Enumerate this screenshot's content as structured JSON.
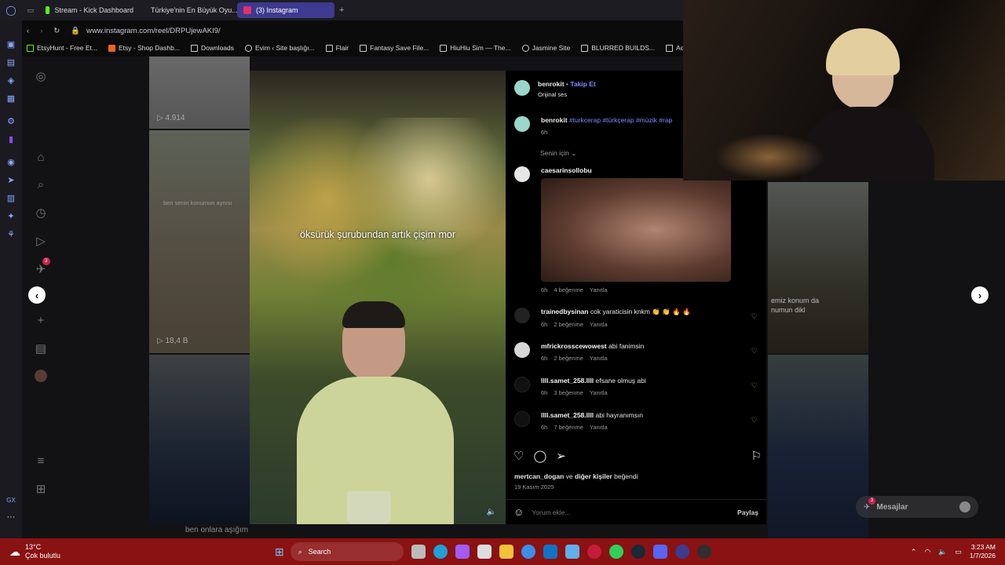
{
  "tabs": [
    {
      "label": "Stream - Kick Dashboard",
      "color": "#53fc18"
    },
    {
      "label": "Türkiye'nin En Büyük Oyu...",
      "color": "#f4b400"
    },
    {
      "label": "(3) Instagram",
      "color": "#e1306c"
    }
  ],
  "new_tab": "+",
  "url": "www.instagram.com/reel/DRPUjewAKI9/",
  "bookmarks": [
    "EtsyHunt - Free Et...",
    "Etsy - Shop Dashb...",
    "Downloads",
    "Evim ‹ Site başlığı...",
    "Flair",
    "Fantasy Save File...",
    "HiuHiu Sim — The...",
    "Jasmine Site",
    "BLURRED BUILDS...",
    "Acco"
  ],
  "grid": {
    "views_top": "4.914",
    "overlay_left": "ben senin konumun aynısı",
    "views_mid": "18,4 B",
    "caption_bottom_left": "ben onlara aşığım",
    "overlay_right": "emiz konum da\nnumun dikl"
  },
  "video": {
    "caption": "öksürük şurubundan artık çişim mor"
  },
  "post": {
    "author": "benrokit",
    "follow": "Takip Et",
    "audio": "Orijinal ses",
    "caption_user": "benrokit",
    "caption_tags": "#turkcerap #türkçerap #müzik #rap",
    "caption_time": "6h",
    "sort": "Senin için",
    "comments": [
      {
        "user": "caesarinsollobu",
        "text": "",
        "time": "6h",
        "likes": "4 beğenme",
        "reply": "Yanıtla"
      },
      {
        "user": "trainedbysinan",
        "text": "cok yaraticisin knkm 👏 👏 🔥 🔥",
        "time": "6h",
        "likes": "2 beğenme",
        "reply": "Yanıtla"
      },
      {
        "user": "mfrickrosscewowest",
        "text": "abi fanimsin",
        "time": "6h",
        "likes": "2 beğenme",
        "reply": "Yanıtla"
      },
      {
        "user": "llll.samet_258.llll",
        "text": "efsane olmuş abi",
        "time": "6h",
        "likes": "3 beğenme",
        "reply": "Yanıtla"
      },
      {
        "user": "llll.samet_258.llll",
        "text": "abi hayranımsın",
        "time": "6h",
        "likes": "7 beğenme",
        "reply": "Yanıtla"
      }
    ],
    "liked_by_user": "mertcan_dogan",
    "liked_by_rest": "ve",
    "liked_by_others": "diğer kişiler",
    "liked_by_suffix": "beğendi",
    "date": "19 Kasım 2025",
    "comment_placeholder": "Yorum ekle...",
    "share": "Paylaş"
  },
  "messages": {
    "label": "Mesajlar",
    "badge": "3"
  },
  "nav_badge": "3",
  "taskbar": {
    "temp": "13°C",
    "weather": "Çok bulutlu",
    "search": "Search",
    "time": "3:23 AM",
    "date": "1/7/2026"
  },
  "colors": {
    "accent": "#7c8cff",
    "taskbar": "#8a1212",
    "tab_active": "#3d3a8f"
  }
}
